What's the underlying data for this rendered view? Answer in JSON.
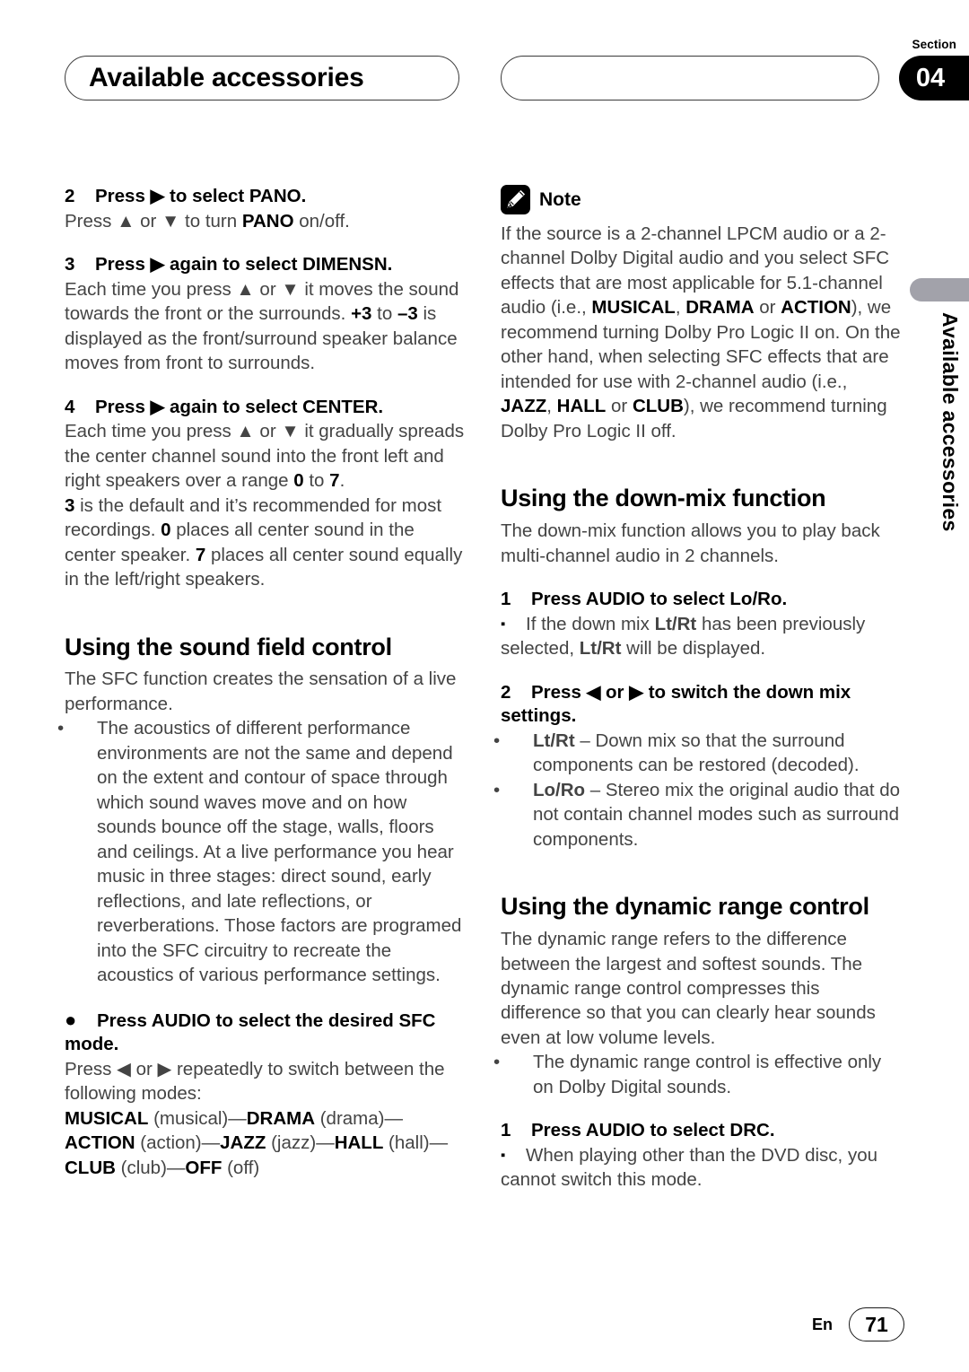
{
  "header": {
    "chapter_title": "Available accessories",
    "section_label": "Section",
    "section_number": "04"
  },
  "margin": {
    "vertical_title": "Available accessories"
  },
  "footer": {
    "language": "En",
    "page_number": "71"
  },
  "left_column": {
    "step2": {
      "num": "2",
      "title_a": "Press ",
      "arrow": "▶",
      "title_b": " to select PANO.",
      "body_a": "Press ",
      "up": "▲",
      "body_b": " or ",
      "down": "▼",
      "body_c": " to turn ",
      "bold_pano": "PANO",
      "body_d": " on/off."
    },
    "step3": {
      "num": "3",
      "title_a": "Press ",
      "arrow": "▶",
      "title_b": " again to select DIMENSN.",
      "body_line1_a": "Each time you press ",
      "up": "▲",
      "body_line1_b": " or ",
      "down": "▼",
      "body_line1_c": " it moves the sound towards the front or the surrounds. ",
      "bold_plus3": "+3",
      "body_mid": " to ",
      "bold_minus3": "–3",
      "body_end": " is displayed as the front/surround speaker balance moves from front to surrounds."
    },
    "step4": {
      "num": "4",
      "title_a": "Press ",
      "arrow": "▶",
      "title_b": " again to select CENTER.",
      "p1_a": "Each time you press ",
      "up": "▲",
      "p1_b": " or ",
      "down": "▼",
      "p1_c": " it gradually spreads the center channel sound into the front left and right speakers over a range ",
      "bold_0": "0",
      "p1_d": " to ",
      "bold_7": "7",
      "p1_e": ".",
      "p2_bold_3": "3",
      "p2_a": " is the default and it’s recommended for most recordings. ",
      "p2_bold_0": "0",
      "p2_b": " places all center sound in the center speaker. ",
      "p2_bold_7": "7",
      "p2_c": " places all center sound equally in the left/right speakers."
    },
    "sfc": {
      "heading": "Using the sound field control",
      "intro": "The SFC function creates the sensation of a live performance.",
      "bullet1": "The acoustics of different performance environments are not the same and depend on the extent and contour of space through which sound waves move and on how sounds bounce off the stage, walls, floors and ceilings. At a live performance you hear music in three stages: direct sound, early reflections, and late reflections, or reverberations. Those factors are programed into the SFC circuitry to recreate the acoustics of various performance settings.",
      "action_bullet": "●",
      "action_title": "Press AUDIO to select the desired SFC mode.",
      "action_body_a": "Press ",
      "left_arrow": "◀",
      "action_body_b": " or ",
      "right_arrow": "▶",
      "action_body_c": " repeatedly to switch between the following modes:",
      "modes": [
        {
          "name": "MUSICAL",
          "paren": " (musical)",
          "sep": "—"
        },
        {
          "name": "DRAMA",
          "paren": " (drama)",
          "sep": "—"
        },
        {
          "name": "ACTION",
          "paren": " (action)",
          "sep": "—"
        },
        {
          "name": "JAZZ",
          "paren": " (jazz)",
          "sep": "—"
        },
        {
          "name": "HALL",
          "paren": " (hall)",
          "sep": "—"
        },
        {
          "name": "CLUB",
          "paren": " (club)",
          "sep": "—"
        },
        {
          "name": "OFF",
          "paren": " (off)",
          "sep": ""
        }
      ]
    }
  },
  "right_column": {
    "note": {
      "icon": "pencil-icon",
      "title": "Note",
      "text_a": "If the source is a 2-channel LPCM audio or a 2-channel Dolby Digital audio and you select SFC effects that are most applicable for 5.1-channel audio (i.e., ",
      "b1": "MUSICAL",
      "text_b": ", ",
      "b2": "DRAMA",
      "text_c": " or ",
      "b3": "ACTION",
      "text_d": "), we recommend turning Dolby Pro Logic II on. On the other hand, when selecting SFC effects that are intended for use with 2-channel audio (i.e., ",
      "b4": "JAZZ",
      "text_e": ", ",
      "b5": "HALL",
      "text_f": " or ",
      "b6": "CLUB",
      "text_g": "), we recommend turning Dolby Pro Logic II off."
    },
    "downmix": {
      "heading": "Using the down-mix function",
      "intro": "The down-mix function allows you to play back multi-channel audio in 2 channels.",
      "step1_num": "1",
      "step1_title": "Press AUDIO to select Lo/Ro.",
      "step1_sq": "▪",
      "step1_note_a": "If the down mix ",
      "step1_note_b1": "Lt/Rt",
      "step1_note_b": " has been previously selected, ",
      "step1_note_b2": "Lt/Rt",
      "step1_note_c": " will be displayed.",
      "step2_num": "2",
      "step2_title_a": "Press ",
      "left_arrow": "◀",
      "step2_title_b": " or ",
      "right_arrow": "▶",
      "step2_title_c": " to switch the down mix settings.",
      "bullets": [
        {
          "term": "Lt/Rt",
          "dash": " – ",
          "text": "Down mix so that the surround components can be restored (decoded)."
        },
        {
          "term": "Lo/Ro",
          "dash": " – ",
          "text": "Stereo mix the original audio that do not contain channel modes such as surround components."
        }
      ]
    },
    "drc": {
      "heading": "Using the dynamic range control",
      "intro": "The dynamic range refers to the difference between the largest and softest sounds. The dynamic range control compresses this difference so that you can clearly hear sounds even at low volume levels.",
      "bullet1": "The dynamic range control is effective only on Dolby Digital sounds.",
      "step1_num": "1",
      "step1_title": "Press AUDIO to select DRC.",
      "step1_sq": "▪",
      "step1_note": "When playing other than the DVD disc, you cannot switch this mode."
    }
  }
}
